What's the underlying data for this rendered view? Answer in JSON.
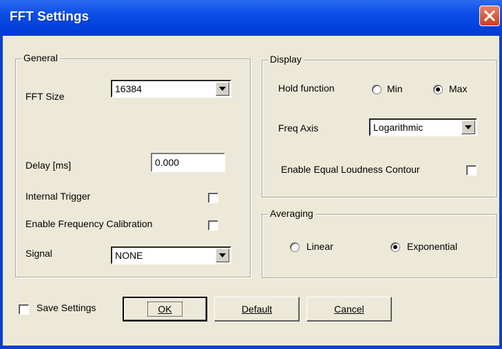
{
  "window": {
    "title": "FFT Settings",
    "close_icon": "close-icon"
  },
  "general": {
    "legend": "General",
    "fft_size_label": "FFT Size",
    "fft_size_value": "16384",
    "delay_label": "Delay [ms]",
    "delay_value": "0.000",
    "internal_trigger_label": "Internal Trigger",
    "internal_trigger_checked": false,
    "freq_calibration_label": "Enable Frequency Calibration",
    "freq_calibration_checked": false,
    "signal_label": "Signal",
    "signal_value": "NONE"
  },
  "display": {
    "legend": "Display",
    "hold_function_label": "Hold function",
    "hold_min_label": "Min",
    "hold_max_label": "Max",
    "hold_selected": "Max",
    "freq_axis_label": "Freq Axis",
    "freq_axis_value": "Logarithmic",
    "equal_loudness_label": "Enable Equal Loudness Contour",
    "equal_loudness_checked": false
  },
  "averaging": {
    "legend": "Averaging",
    "linear_label": "Linear",
    "exponential_label": "Exponential",
    "selected": "Exponential"
  },
  "footer": {
    "save_settings_label": "Save Settings",
    "save_settings_checked": false,
    "ok_label": "OK",
    "default_label": "Default",
    "cancel_label": "Cancel"
  }
}
